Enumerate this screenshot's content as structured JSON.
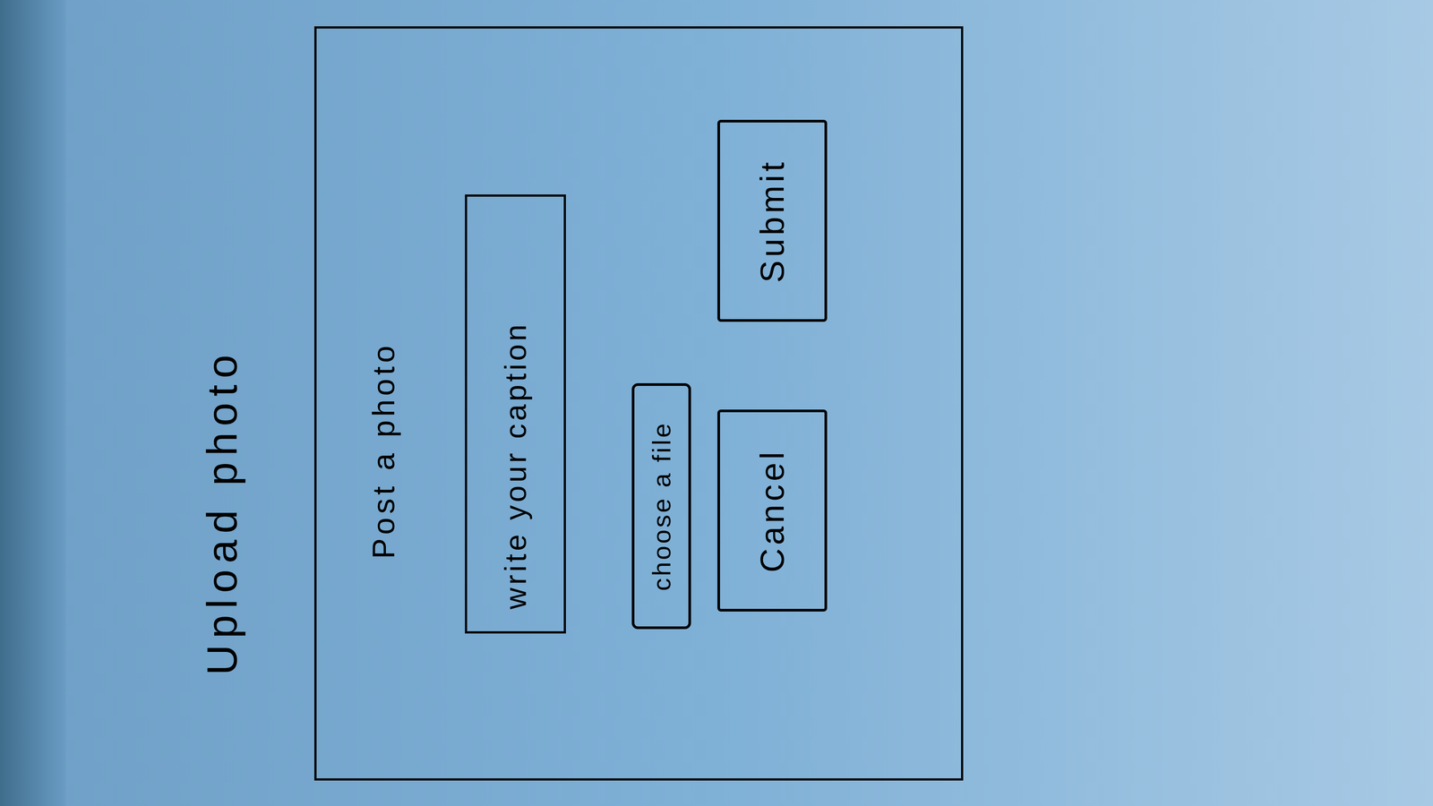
{
  "page": {
    "title": "Upload photo"
  },
  "dialog": {
    "title": "Post a photo",
    "caption_field": {
      "placeholder": "write your caption"
    },
    "file_button": {
      "label": "choose a file"
    },
    "buttons": [
      "Cancel",
      "Submit"
    ]
  }
}
